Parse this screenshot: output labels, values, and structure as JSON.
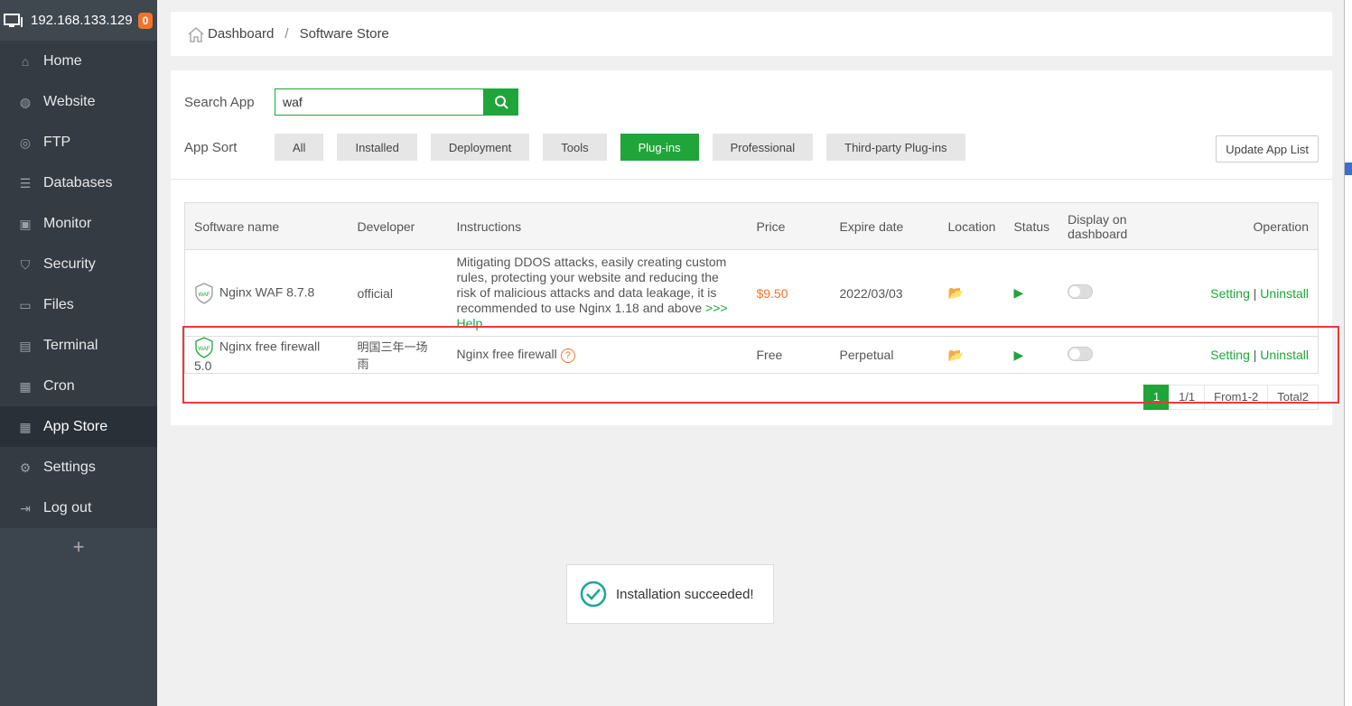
{
  "sidebar": {
    "host": "192.168.133.129",
    "badge": "0",
    "items": [
      {
        "label": "Home",
        "icon": "home-icon"
      },
      {
        "label": "Website",
        "icon": "globe-icon"
      },
      {
        "label": "FTP",
        "icon": "ftp-icon"
      },
      {
        "label": "Databases",
        "icon": "database-icon"
      },
      {
        "label": "Monitor",
        "icon": "monitor-icon"
      },
      {
        "label": "Security",
        "icon": "shield-icon"
      },
      {
        "label": "Files",
        "icon": "folder-icon"
      },
      {
        "label": "Terminal",
        "icon": "terminal-icon"
      },
      {
        "label": "Cron",
        "icon": "calendar-icon"
      },
      {
        "label": "App Store",
        "icon": "apps-icon",
        "active": true
      },
      {
        "label": "Settings",
        "icon": "gear-icon"
      },
      {
        "label": "Log out",
        "icon": "logout-icon"
      }
    ],
    "add": "+"
  },
  "breadcrumb": {
    "home": "Dashboard",
    "sep": "/",
    "current": "Software Store"
  },
  "search": {
    "label": "Search App",
    "value": "waf"
  },
  "sort": {
    "label": "App Sort",
    "options": [
      "All",
      "Installed",
      "Deployment",
      "Tools",
      "Plug-ins",
      "Professional",
      "Third-party Plug-ins"
    ],
    "selected": "Plug-ins"
  },
  "update_button": "Update App List",
  "table": {
    "headers": [
      "Software name",
      "Developer",
      "Instructions",
      "Price",
      "Expire date",
      "Location",
      "Status",
      "Display on dashboard",
      "Operation"
    ],
    "rows": [
      {
        "name": "Nginx WAF 8.7.8",
        "developer": "official",
        "instructions": "Mitigating DDOS attacks, easily creating custom rules, protecting your website and reducing the risk of malicious attacks and data leakage, it is recommended to use Nginx 1.18 and above",
        "help": ">>> Help",
        "price": "$9.50",
        "expire": "2022/03/03",
        "setting": "Setting",
        "sep": "|",
        "uninstall": "Uninstall"
      },
      {
        "name": "Nginx free firewall 5.0",
        "developer": "明国三年一场雨",
        "instructions": "Nginx free firewall",
        "help_icon": "?",
        "price": "Free",
        "expire": "Perpetual",
        "setting": "Setting",
        "sep": "|",
        "uninstall": "Uninstall"
      }
    ]
  },
  "pager": {
    "current": "1",
    "pages": "1/1",
    "range": "From1-2",
    "total": "Total2"
  },
  "toast": "Installation succeeded!",
  "colors": {
    "accent": "#20a53a",
    "price": "#f0742a",
    "highlight": "#e83a3a"
  }
}
